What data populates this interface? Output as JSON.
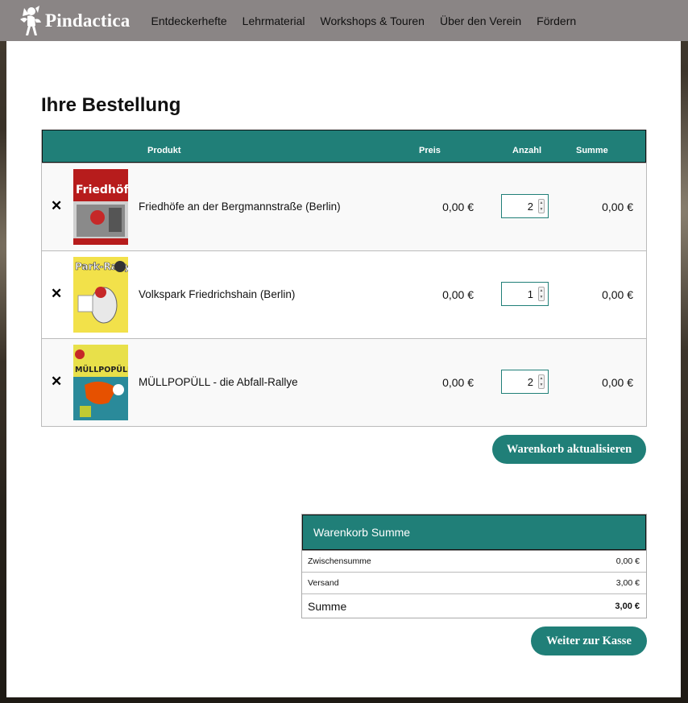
{
  "brand": {
    "name": "Pindactica"
  },
  "nav": [
    {
      "label": "Entdeckerhefte"
    },
    {
      "label": "Lehrmaterial"
    },
    {
      "label": "Workshops & Touren"
    },
    {
      "label": "Über den Verein"
    },
    {
      "label": "Fördern"
    }
  ],
  "page": {
    "title": "Ihre Bestellung"
  },
  "table": {
    "headers": {
      "product": "Produkt",
      "price": "Preis",
      "quantity": "Anzahl",
      "total": "Summe"
    },
    "rows": [
      {
        "name": "Friedhöfe an der Bergmannstraße (Berlin)",
        "price": "0,00 €",
        "qty": "2",
        "total": "0,00 €",
        "thumb_title": "Friedhöfe"
      },
      {
        "name": "Volkspark Friedrichshain (Berlin)",
        "price": "0,00 €",
        "qty": "1",
        "total": "0,00 €",
        "thumb_title": "Park-Rallye"
      },
      {
        "name": "MÜLLPOPÜLL - die Abfall-Rallye",
        "price": "0,00 €",
        "qty": "2",
        "total": "0,00 €",
        "thumb_title": "MÜLLPOPÜLL"
      }
    ],
    "remove_symbol": "✕"
  },
  "buttons": {
    "update": "Warenkorb aktualisieren",
    "checkout": "Weiter zur Kasse"
  },
  "totals": {
    "title": "Warenkorb Summe",
    "subtotal_label": "Zwischensumme",
    "subtotal": "0,00 €",
    "shipping_label": "Versand",
    "shipping": "3,00 €",
    "sum_label": "Summe",
    "sum": "3,00 €"
  },
  "colors": {
    "accent": "#207f78",
    "topbar": "#8a8585"
  }
}
